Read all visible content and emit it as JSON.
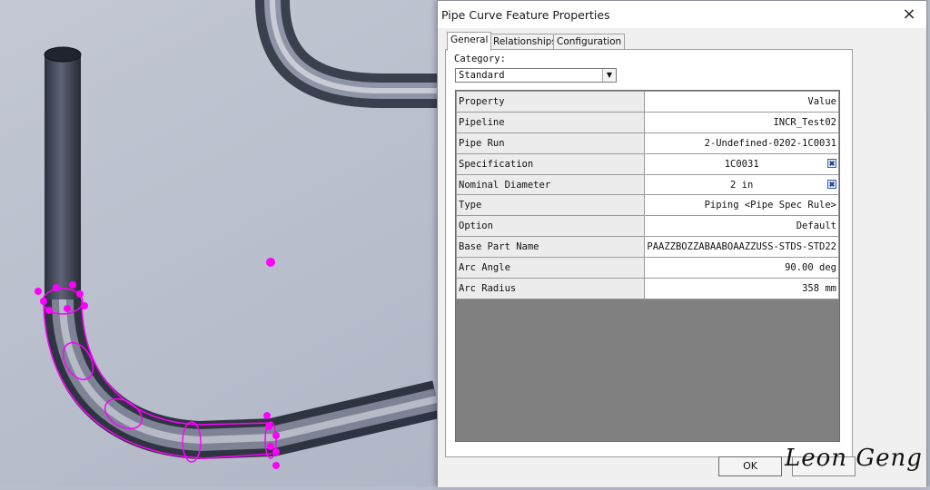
{
  "dialog": {
    "title": "Pipe Curve Feature Properties",
    "close_glyph": "×",
    "tabs": [
      {
        "label": "General",
        "active": true
      },
      {
        "label": "Relationships",
        "active": false
      },
      {
        "label": "Configuration",
        "active": false
      }
    ],
    "category": {
      "label": "Category:",
      "selected": "Standard"
    },
    "grid": {
      "header": {
        "property": "Property",
        "value": "Value"
      },
      "rows": [
        {
          "property": "Pipeline",
          "value": "INCR_Test02",
          "picker": false
        },
        {
          "property": "Pipe Run",
          "value": "2-Undefined-0202-1C0031",
          "picker": false
        },
        {
          "property": "Specification",
          "value": "1C0031",
          "picker": true
        },
        {
          "property": "Nominal Diameter",
          "value": "2 in",
          "picker": true
        },
        {
          "property": "Type",
          "value": "Piping <Pipe Spec Rule>",
          "picker": false
        },
        {
          "property": "Option",
          "value": "Default",
          "picker": false
        },
        {
          "property": "Base Part Name",
          "value": "PAAZZBOZZABAABOAAZZUSS-STDS-STD22",
          "picker": false
        },
        {
          "property": "Arc Angle",
          "value": "90.00 deg",
          "picker": false
        },
        {
          "property": "Arc Radius",
          "value": "358 mm",
          "picker": false
        }
      ]
    },
    "buttons": {
      "ok": "OK"
    }
  },
  "watermark": "Leon Geng",
  "colors": {
    "viewport_bg": "#b7bdcb",
    "selection_highlight": "#ff00ff",
    "grid_empty": "#808080"
  },
  "icons": {
    "close": "close-icon",
    "dropdown": "chevron-down-icon",
    "picker": "pick-icon"
  }
}
